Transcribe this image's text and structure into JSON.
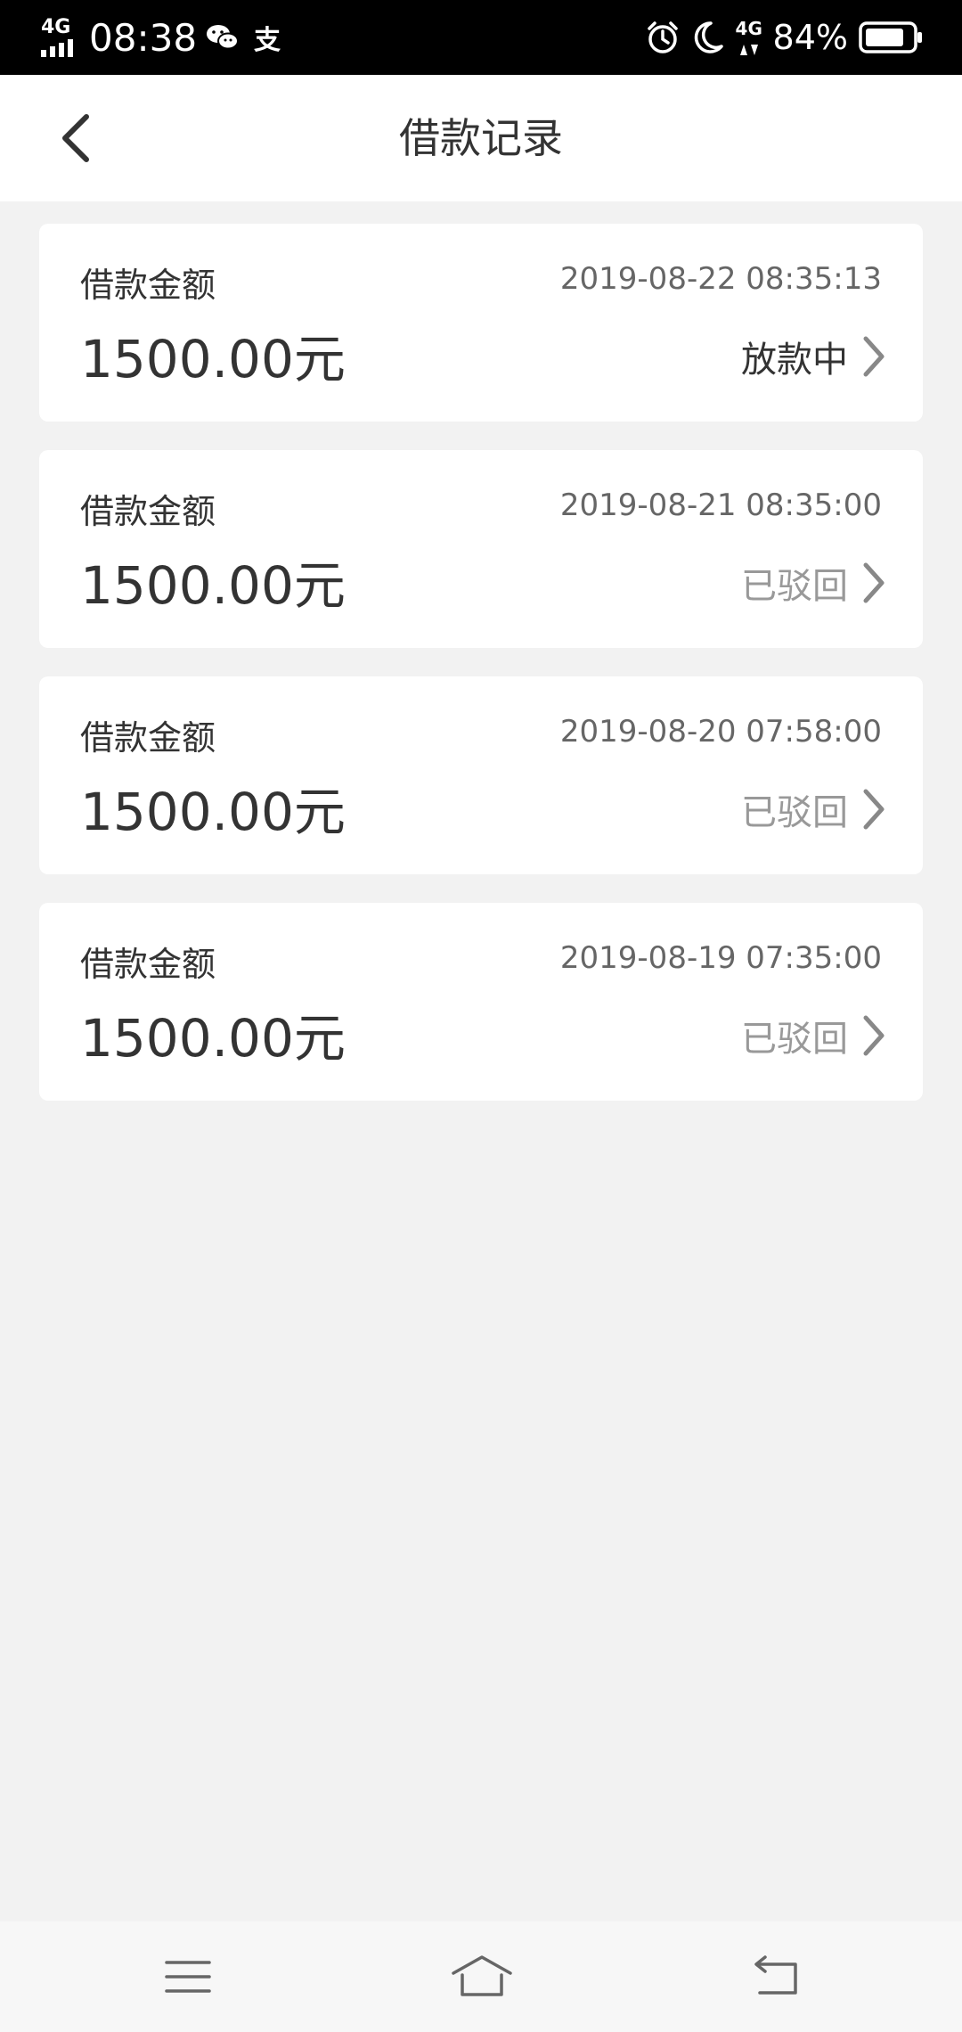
{
  "status_bar": {
    "network_left": "4G",
    "time": "08:38",
    "app_icons": [
      "wechat-icon",
      "alipay-icon"
    ],
    "alipay_glyph": "支",
    "network_right": "4G",
    "battery_percent": "84%",
    "battery_level": 0.84
  },
  "header": {
    "title": "借款记录",
    "back_icon": "chevron-left-icon"
  },
  "records": [
    {
      "label": "借款金额",
      "amount": "1500.00元",
      "date": "2019-08-22 08:35:13",
      "status": "放款中",
      "status_color": "#333333"
    },
    {
      "label": "借款金额",
      "amount": "1500.00元",
      "date": "2019-08-21 08:35:00",
      "status": "已驳回",
      "status_color": "#999999"
    },
    {
      "label": "借款金额",
      "amount": "1500.00元",
      "date": "2019-08-20 07:58:00",
      "status": "已驳回",
      "status_color": "#999999"
    },
    {
      "label": "借款金额",
      "amount": "1500.00元",
      "date": "2019-08-19 07:35:00",
      "status": "已驳回",
      "status_color": "#999999"
    }
  ],
  "nav": {
    "icons": [
      "menu-icon",
      "home-icon",
      "back-icon"
    ]
  }
}
